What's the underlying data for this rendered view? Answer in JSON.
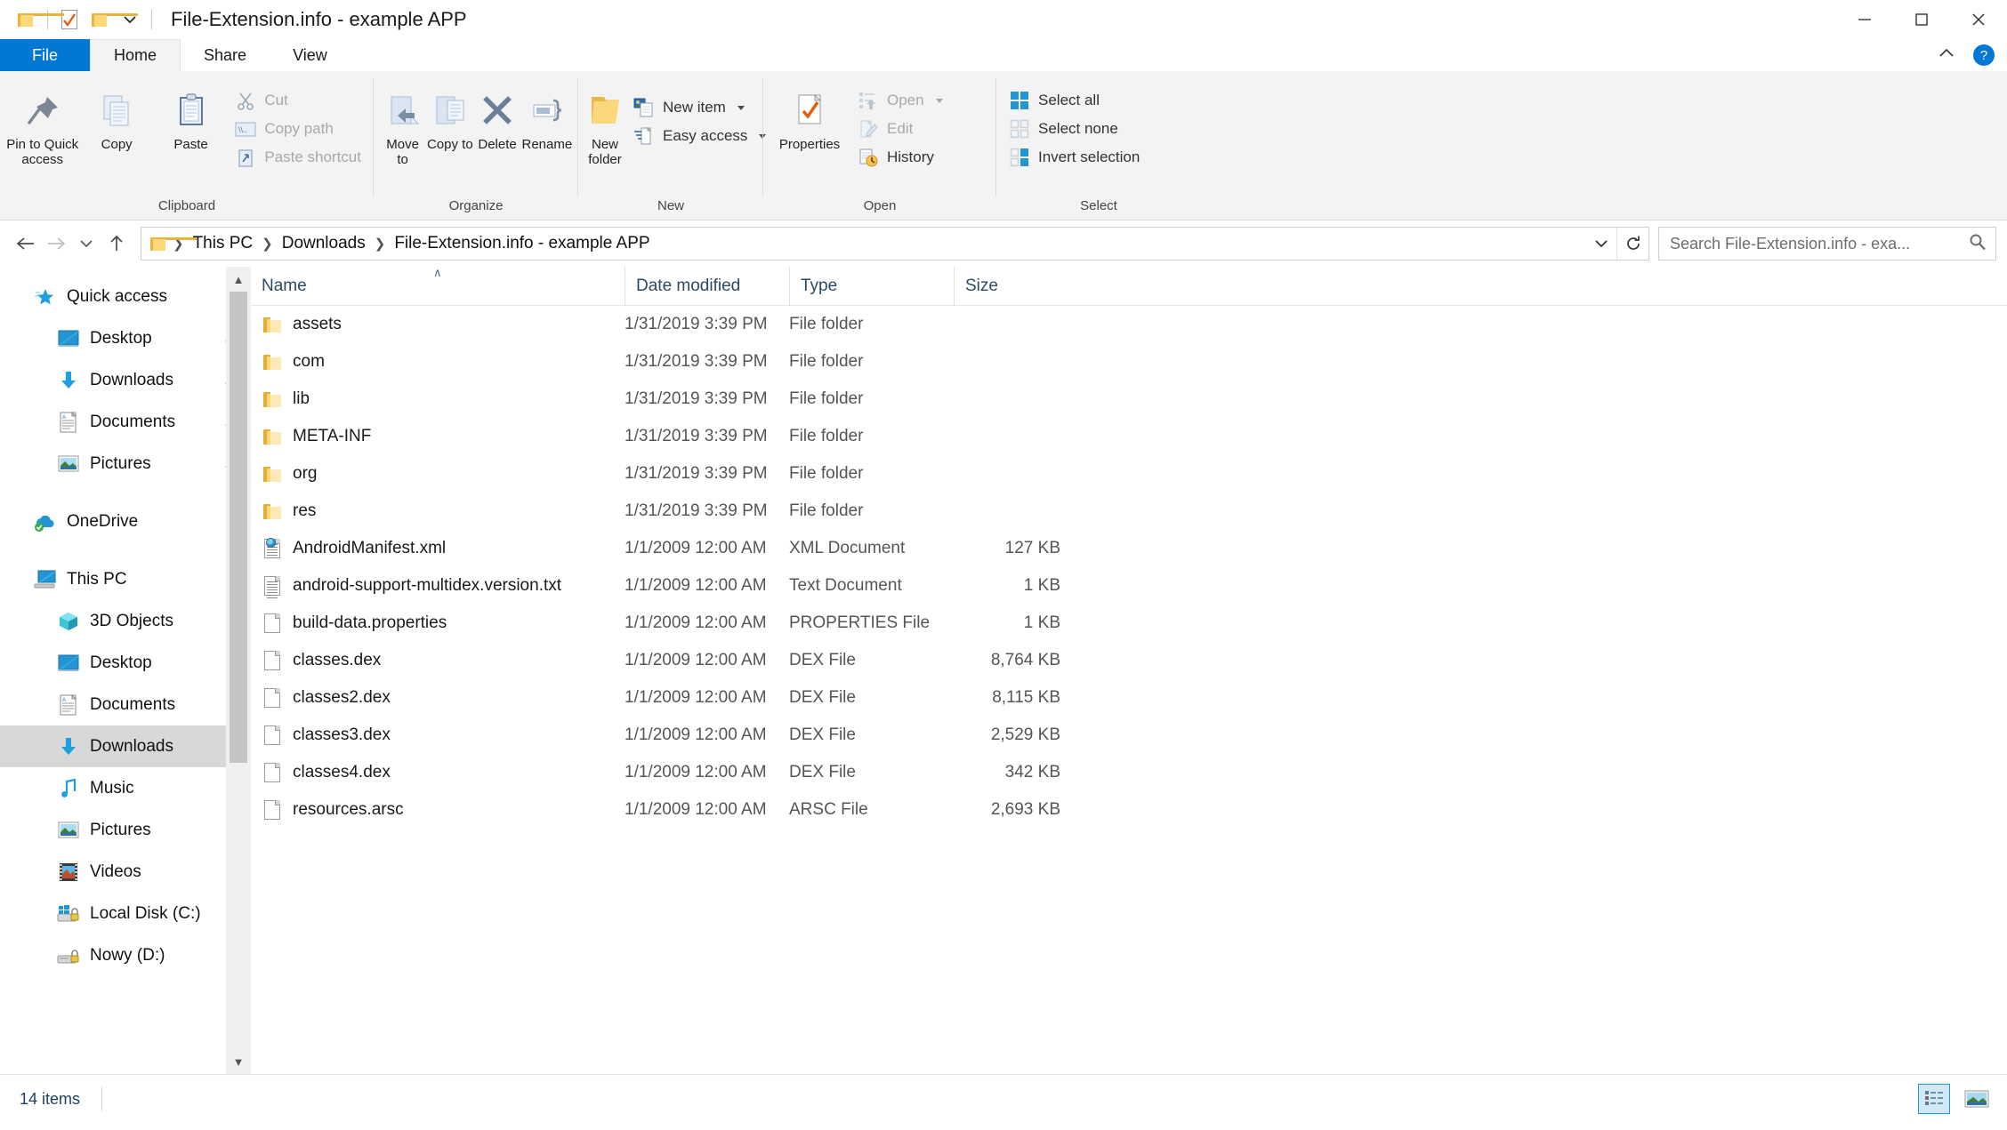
{
  "window": {
    "title": "File-Extension.info - example APP",
    "quick_access_icons": [
      "folder-icon",
      "properties-check-icon",
      "new-folder-icon",
      "customize-qat-chevron-icon"
    ],
    "controls": {
      "minimize": "minimize-icon",
      "maximize": "maximize-icon",
      "close": "close-icon"
    }
  },
  "ribbon": {
    "tabs": [
      {
        "label": "File",
        "active": false,
        "kind": "file"
      },
      {
        "label": "Home",
        "active": true,
        "kind": "normal"
      },
      {
        "label": "Share",
        "active": false,
        "kind": "normal"
      },
      {
        "label": "View",
        "active": false,
        "kind": "normal"
      }
    ],
    "collapse_icon": "chevron-up-icon",
    "help_label": "?",
    "groups": [
      {
        "name": "Clipboard",
        "label": "Clipboard",
        "big_buttons": [
          {
            "label": "Pin to Quick access",
            "icon": "pin-icon"
          },
          {
            "label": "Copy",
            "icon": "copy-icon"
          },
          {
            "label": "Paste",
            "icon": "paste-icon"
          }
        ],
        "small_buttons": [
          {
            "label": "Cut",
            "icon": "scissors-icon",
            "enabled": false
          },
          {
            "label": "Copy path",
            "icon": "copy-path-icon",
            "enabled": false
          },
          {
            "label": "Paste shortcut",
            "icon": "paste-shortcut-icon",
            "enabled": false
          }
        ]
      },
      {
        "name": "Organize",
        "label": "Organize",
        "big_buttons": [
          {
            "label": "Move to",
            "icon": "move-to-icon",
            "has_caret": true
          },
          {
            "label": "Copy to",
            "icon": "copy-to-icon",
            "has_caret": true
          },
          {
            "label": "Delete",
            "icon": "delete-x-icon",
            "has_caret": true
          },
          {
            "label": "Rename",
            "icon": "rename-icon"
          }
        ]
      },
      {
        "name": "New",
        "label": "New",
        "big_buttons": [
          {
            "label": "New folder",
            "icon": "new-folder-icon"
          }
        ],
        "small_buttons": [
          {
            "label": "New item",
            "icon": "new-item-icon",
            "has_caret": true,
            "enabled": true
          },
          {
            "label": "Easy access",
            "icon": "easy-access-icon",
            "has_caret": true,
            "enabled": true
          }
        ]
      },
      {
        "name": "Open",
        "label": "Open",
        "big_buttons": [
          {
            "label": "Properties",
            "icon": "properties-icon",
            "has_caret": true
          }
        ],
        "small_buttons": [
          {
            "label": "Open",
            "icon": "open-icon",
            "has_caret": true,
            "enabled": false
          },
          {
            "label": "Edit",
            "icon": "edit-icon",
            "enabled": false
          },
          {
            "label": "History",
            "icon": "history-icon",
            "enabled": true
          }
        ]
      },
      {
        "name": "Select",
        "label": "Select",
        "small_buttons": [
          {
            "label": "Select all",
            "icon": "select-all-icon",
            "enabled": true
          },
          {
            "label": "Select none",
            "icon": "select-none-icon",
            "enabled": true
          },
          {
            "label": "Invert selection",
            "icon": "invert-selection-icon",
            "enabled": true
          }
        ]
      }
    ]
  },
  "address_bar": {
    "back_icon": "arrow-left-icon",
    "forward_icon": "arrow-right-icon",
    "recent_icon": "chevron-down-icon",
    "up_icon": "arrow-up-icon",
    "folder_icon": "folder-icon",
    "crumbs": [
      "This PC",
      "Downloads",
      "File-Extension.info - example APP"
    ],
    "dropdown_icon": "chevron-down-icon",
    "refresh_icon": "refresh-icon",
    "search_placeholder": "Search File-Extension.info - exa...",
    "search_icon": "search-icon"
  },
  "sidebar": {
    "scroll_up_icon": "chevron-up-icon",
    "scroll_down_icon": "chevron-down-icon",
    "items": [
      {
        "label": "Quick access",
        "icon": "quick-access-star-icon",
        "level": 0,
        "pinned": false,
        "selected": false
      },
      {
        "label": "Desktop",
        "icon": "desktop-icon",
        "level": 1,
        "pinned": true,
        "selected": false
      },
      {
        "label": "Downloads",
        "icon": "downloads-arrow-icon",
        "level": 1,
        "pinned": true,
        "selected": false
      },
      {
        "label": "Documents",
        "icon": "documents-icon",
        "level": 1,
        "pinned": true,
        "selected": false
      },
      {
        "label": "Pictures",
        "icon": "pictures-icon",
        "level": 1,
        "pinned": true,
        "selected": false
      },
      {
        "label": "OneDrive",
        "icon": "onedrive-cloud-icon",
        "level": 0,
        "pinned": false,
        "selected": false,
        "gap_before": true
      },
      {
        "label": "This PC",
        "icon": "this-pc-icon",
        "level": 0,
        "pinned": false,
        "selected": false,
        "gap_before": true
      },
      {
        "label": "3D Objects",
        "icon": "3d-objects-icon",
        "level": 1,
        "pinned": false,
        "selected": false
      },
      {
        "label": "Desktop",
        "icon": "desktop-icon",
        "level": 1,
        "pinned": false,
        "selected": false
      },
      {
        "label": "Documents",
        "icon": "documents-icon",
        "level": 1,
        "pinned": false,
        "selected": false
      },
      {
        "label": "Downloads",
        "icon": "downloads-arrow-icon",
        "level": 1,
        "pinned": false,
        "selected": true
      },
      {
        "label": "Music",
        "icon": "music-note-icon",
        "level": 1,
        "pinned": false,
        "selected": false
      },
      {
        "label": "Pictures",
        "icon": "pictures-icon",
        "level": 1,
        "pinned": false,
        "selected": false
      },
      {
        "label": "Videos",
        "icon": "videos-icon",
        "level": 1,
        "pinned": false,
        "selected": false
      },
      {
        "label": "Local Disk (C:)",
        "icon": "local-disk-icon",
        "level": 1,
        "pinned": false,
        "selected": false
      },
      {
        "label": "Nowy (D:)",
        "icon": "drive-icon",
        "level": 1,
        "pinned": false,
        "selected": false
      }
    ]
  },
  "file_list": {
    "columns": [
      {
        "key": "name",
        "label": "Name",
        "sorted": "asc"
      },
      {
        "key": "date",
        "label": "Date modified",
        "sorted": null
      },
      {
        "key": "type",
        "label": "Type",
        "sorted": null
      },
      {
        "key": "size",
        "label": "Size",
        "sorted": null
      }
    ],
    "sort_marker": "∧",
    "rows": [
      {
        "name": "assets",
        "date": "1/31/2019 3:39 PM",
        "type": "File folder",
        "size": "",
        "icon": "folder-icon"
      },
      {
        "name": "com",
        "date": "1/31/2019 3:39 PM",
        "type": "File folder",
        "size": "",
        "icon": "folder-icon"
      },
      {
        "name": "lib",
        "date": "1/31/2019 3:39 PM",
        "type": "File folder",
        "size": "",
        "icon": "folder-icon"
      },
      {
        "name": "META-INF",
        "date": "1/31/2019 3:39 PM",
        "type": "File folder",
        "size": "",
        "icon": "folder-icon"
      },
      {
        "name": "org",
        "date": "1/31/2019 3:39 PM",
        "type": "File folder",
        "size": "",
        "icon": "folder-icon"
      },
      {
        "name": "res",
        "date": "1/31/2019 3:39 PM",
        "type": "File folder",
        "size": "",
        "icon": "folder-icon"
      },
      {
        "name": "AndroidManifest.xml",
        "date": "1/1/2009 12:00 AM",
        "type": "XML Document",
        "size": "127 KB",
        "icon": "xml-document-icon"
      },
      {
        "name": "android-support-multidex.version.txt",
        "date": "1/1/2009 12:00 AM",
        "type": "Text Document",
        "size": "1 KB",
        "icon": "text-document-icon"
      },
      {
        "name": "build-data.properties",
        "date": "1/1/2009 12:00 AM",
        "type": "PROPERTIES File",
        "size": "1 KB",
        "icon": "blank-file-icon"
      },
      {
        "name": "classes.dex",
        "date": "1/1/2009 12:00 AM",
        "type": "DEX File",
        "size": "8,764 KB",
        "icon": "blank-file-icon"
      },
      {
        "name": "classes2.dex",
        "date": "1/1/2009 12:00 AM",
        "type": "DEX File",
        "size": "8,115 KB",
        "icon": "blank-file-icon"
      },
      {
        "name": "classes3.dex",
        "date": "1/1/2009 12:00 AM",
        "type": "DEX File",
        "size": "2,529 KB",
        "icon": "blank-file-icon"
      },
      {
        "name": "classes4.dex",
        "date": "1/1/2009 12:00 AM",
        "type": "DEX File",
        "size": "342 KB",
        "icon": "blank-file-icon"
      },
      {
        "name": "resources.arsc",
        "date": "1/1/2009 12:00 AM",
        "type": "ARSC File",
        "size": "2,693 KB",
        "icon": "blank-file-icon"
      }
    ]
  },
  "status_bar": {
    "item_count": "14 items",
    "views": [
      {
        "name": "details-view-button",
        "icon": "details-view-icon",
        "active": true
      },
      {
        "name": "large-icons-view-button",
        "icon": "large-icons-view-icon",
        "active": false
      }
    ]
  },
  "colors": {
    "accent": "#0078d4",
    "ribbon_bg": "#f3f3f3",
    "selection": "#d8d8d8",
    "header_text": "#2b4a66",
    "folder_yellow": "#fbd77c"
  }
}
